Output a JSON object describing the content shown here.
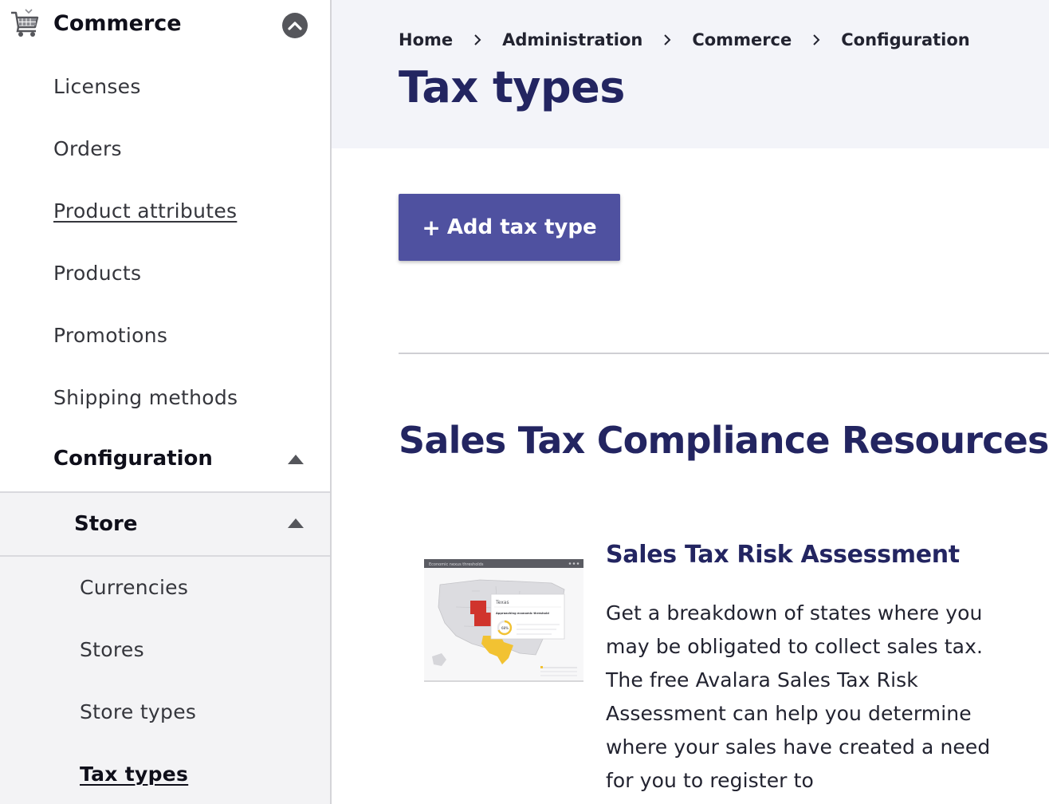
{
  "sidebar": {
    "header_label": "Commerce",
    "items": [
      {
        "label": "Licenses"
      },
      {
        "label": "Orders"
      },
      {
        "label": "Product attributes"
      },
      {
        "label": "Products"
      },
      {
        "label": "Promotions"
      },
      {
        "label": "Shipping methods"
      }
    ],
    "configuration_label": "Configuration",
    "store_label": "Store",
    "store_items": [
      {
        "label": "Currencies"
      },
      {
        "label": "Stores"
      },
      {
        "label": "Store types"
      },
      {
        "label": "Tax types"
      }
    ]
  },
  "breadcrumb": [
    "Home",
    "Administration",
    "Commerce",
    "Configuration"
  ],
  "page_title": "Tax types",
  "add_button_label": "Add tax type",
  "section_title": "Sales Tax Compliance Resources",
  "resource": {
    "title": "Sales Tax Risk Assessment",
    "description": "Get a breakdown of states where you may be obligated to collect sales tax. The free Avalara Sales Tax Risk Assessment can help you determine where your sales have created a need for you to register to",
    "thumbnail": {
      "header_text": "Economic nexus thresholds",
      "state_label": "Texas",
      "status_text": "Approaching economic threshold",
      "percent_text": "68%"
    }
  },
  "colors": {
    "title_navy": "#232561",
    "button_bg": "#4f51a0",
    "header_bg": "#f3f4f9",
    "sidebar_sub_bg": "#f3f3f5"
  },
  "icons": [
    "cart-icon",
    "collapse-circle-up-icon",
    "chevron-right-icon",
    "triangle-up-icon",
    "plus-icon"
  ]
}
